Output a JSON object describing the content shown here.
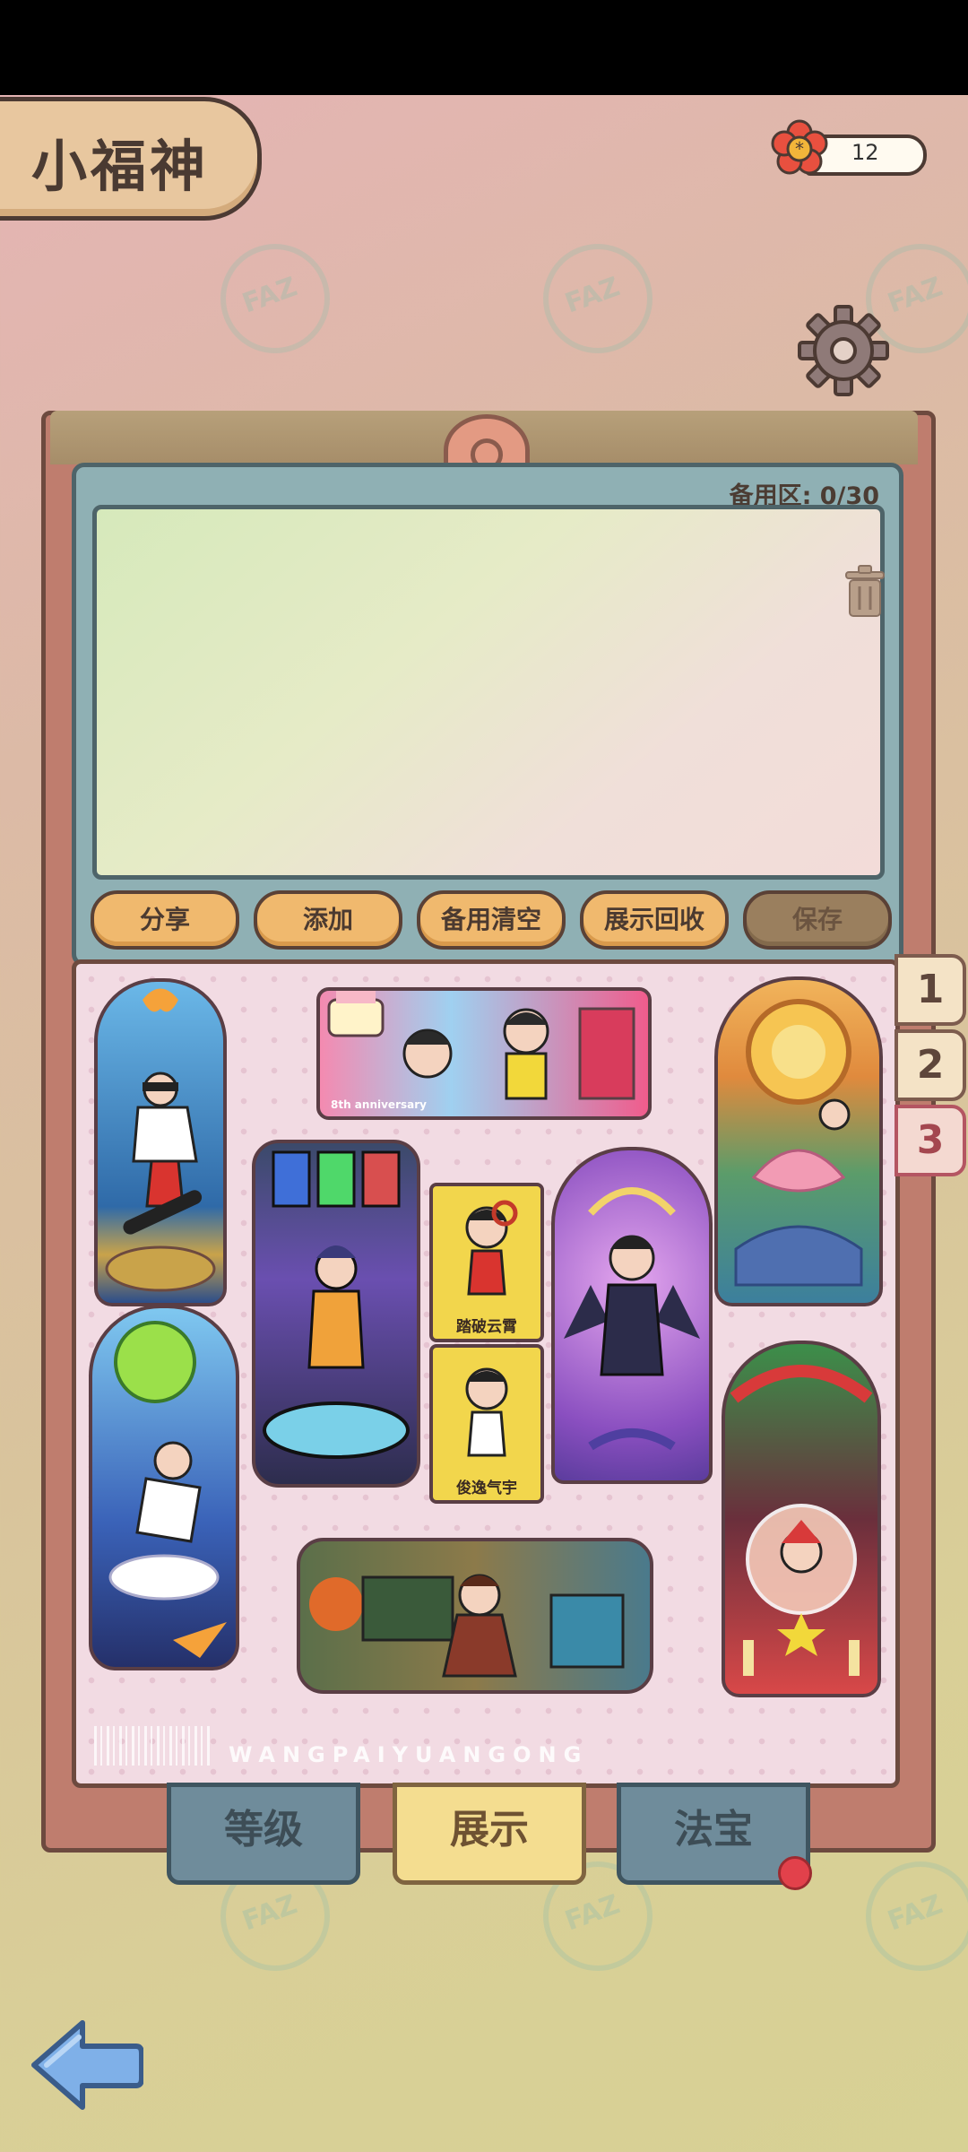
{
  "app": {
    "title": "小福神"
  },
  "currency": {
    "icon": "plum-flower-icon",
    "count": "12"
  },
  "settings": {
    "icon": "gear-icon"
  },
  "reserve": {
    "label": "备用区: 0/30",
    "trash_icon": "trash-icon"
  },
  "actions": {
    "share": "分享",
    "add": "添加",
    "clear_reserve": "备用清空",
    "recycle_display": "展示回收",
    "save": "保存"
  },
  "display": {
    "watermark": "WANGPAIYUANGONG",
    "pages": [
      "1",
      "2",
      "3"
    ],
    "active_page": "3",
    "items": [
      {
        "name": "snowboard-badge"
      },
      {
        "name": "anniversary-badge",
        "text": "8th anniversary"
      },
      {
        "name": "lotus-dragon-badge"
      },
      {
        "name": "cyber-machine-badge"
      },
      {
        "name": "card-tapo-yunxiao",
        "text": "踏破云霄"
      },
      {
        "name": "card-junyi-qiyu",
        "text": "俊逸气宇"
      },
      {
        "name": "angel-frame-badge"
      },
      {
        "name": "space-cloud-badge"
      },
      {
        "name": "christmas-badge"
      },
      {
        "name": "study-desk-badge"
      }
    ]
  },
  "tabs": {
    "level": "等级",
    "display": "展示",
    "treasure": "法宝"
  },
  "nav": {
    "back_icon": "back-arrow-icon"
  },
  "colors": {
    "accent": "#f0b96e",
    "frame": "#bf7d6e",
    "panel": "#8fb0b4",
    "active_tab": "#f4dd90"
  }
}
